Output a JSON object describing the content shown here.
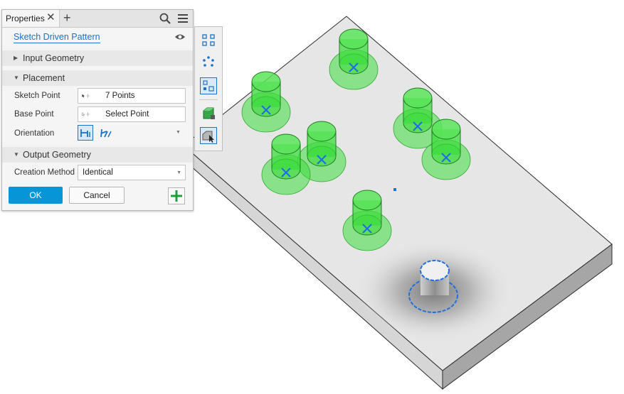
{
  "panel": {
    "tab_label": "Properties",
    "feature_name": "Sketch Driven Pattern",
    "sections": {
      "input_geometry": "Input Geometry",
      "placement": "Placement",
      "output_geometry": "Output Geometry"
    },
    "fields": {
      "sketch_point_label": "Sketch Point",
      "sketch_point_value": "7 Points",
      "base_point_label": "Base Point",
      "base_point_value": "Select Point",
      "orientation_label": "Orientation",
      "creation_method_label": "Creation Method",
      "creation_method_value": "Identical"
    },
    "buttons": {
      "ok": "OK",
      "cancel": "Cancel"
    }
  },
  "icons": {
    "tab_close": "close-icon",
    "tab_add": "plus-icon",
    "search": "search-icon",
    "menu": "hamburger-menu-icon",
    "visibility": "eye-icon",
    "orientation_1": "orientation-identical-icon",
    "orientation_2": "orientation-direction-icon",
    "add_pattern": "plus-icon",
    "toolbar": [
      "rectangular-pattern-icon",
      "circular-pattern-icon",
      "sketch-pattern-icon",
      "solid-body-icon",
      "select-solid-icon"
    ]
  },
  "colors": {
    "accent": "#0696d7",
    "link": "#1a73c9",
    "preview_green": "#3ddc3d",
    "sketch_blue": "#1e6fe0"
  }
}
